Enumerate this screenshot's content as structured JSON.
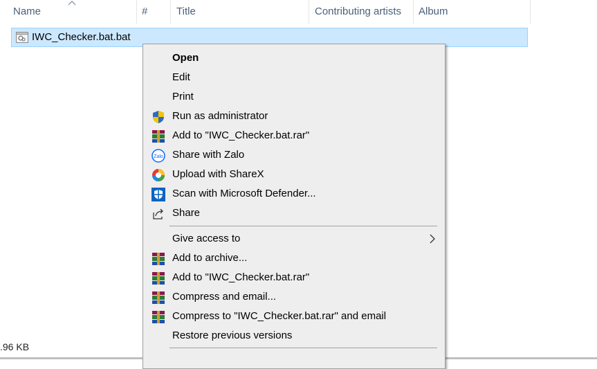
{
  "columns": [
    "Name",
    "#",
    "Title",
    "Contributing artists",
    "Album"
  ],
  "file": {
    "name": "IWC_Checker.bat.bat"
  },
  "status": {
    "size": ".96 KB"
  },
  "menu": {
    "items": [
      {
        "label": "Open",
        "icon": ""
      },
      {
        "label": "Edit",
        "icon": ""
      },
      {
        "label": "Print",
        "icon": ""
      },
      {
        "label": "Run as administrator",
        "icon": "shield-icon"
      },
      {
        "label": "Add to \"IWC_Checker.bat.rar\"",
        "icon": "winrar-icon"
      },
      {
        "label": "Share with Zalo",
        "icon": "zalo-icon"
      },
      {
        "label": "Upload with ShareX",
        "icon": "sharex-icon"
      },
      {
        "label": "Scan with Microsoft Defender...",
        "icon": "defender-icon"
      },
      {
        "label": "Share",
        "icon": "share-icon"
      },
      {
        "label": "Give access to",
        "icon": ""
      },
      {
        "label": "Add to archive...",
        "icon": "winrar-icon"
      },
      {
        "label": "Add to \"IWC_Checker.bat.rar\"",
        "icon": "winrar-icon"
      },
      {
        "label": "Compress and email...",
        "icon": "winrar-icon"
      },
      {
        "label": "Compress to \"IWC_Checker.bat.rar\" and email",
        "icon": "winrar-icon"
      },
      {
        "label": "Restore previous versions",
        "icon": ""
      }
    ]
  },
  "colors": {
    "selection": "#cce8ff",
    "selection_border": "#99d1ff",
    "menu_bg": "#eeeeee",
    "header_text": "#4c607a"
  }
}
